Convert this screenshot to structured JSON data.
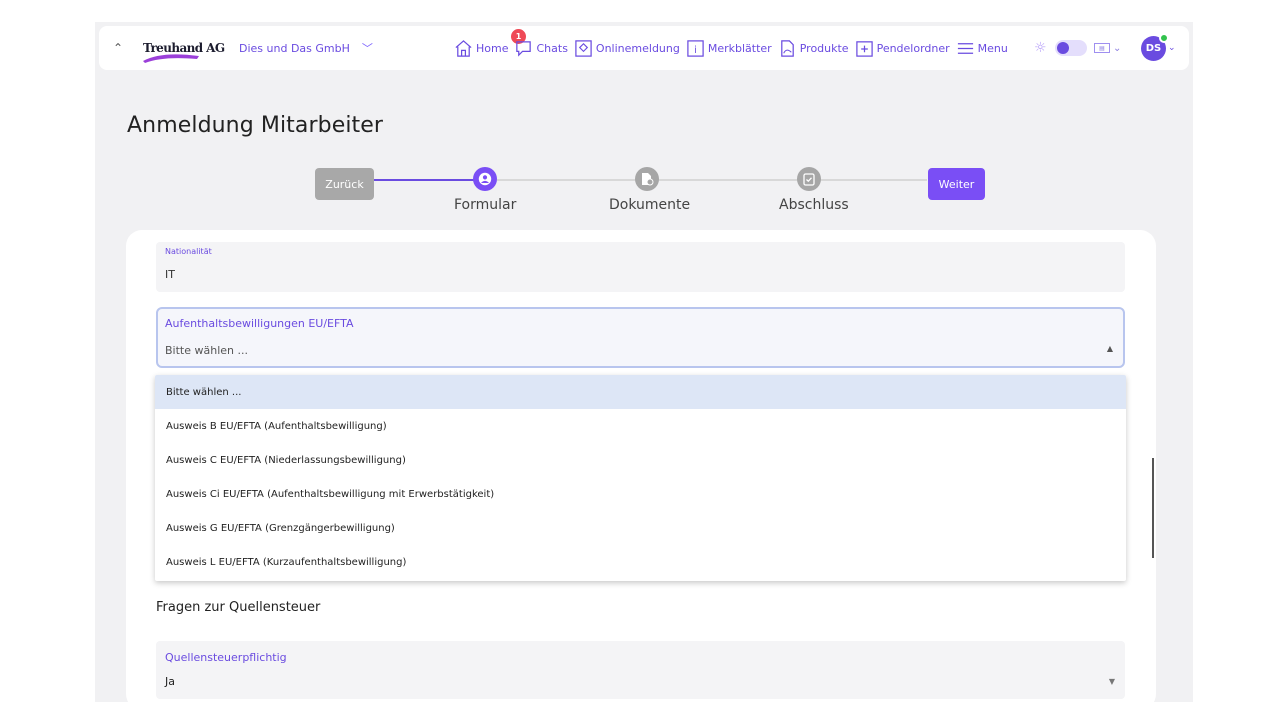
{
  "nav": {
    "logo_text": "Treuhand AG",
    "company": "Dies und Das GmbH",
    "items": [
      {
        "label": "Home",
        "icon": "home-icon",
        "badge": "1"
      },
      {
        "label": "Chats",
        "icon": "chat-icon"
      },
      {
        "label": "Onlinemeldung",
        "icon": "online-report-icon"
      },
      {
        "label": "Merkblätter",
        "icon": "info-sheet-icon"
      },
      {
        "label": "Produkte",
        "icon": "product-document-icon"
      },
      {
        "label": "Pendelordner",
        "icon": "folder-plus-icon"
      },
      {
        "label": "Menu",
        "icon": "hamburger-icon"
      }
    ],
    "user_initials": "DS",
    "colors": {
      "accent": "#6a4be0",
      "badge": "#ef4a57",
      "online": "#32c24d"
    }
  },
  "page": {
    "title": "Anmeldung Mitarbeiter",
    "back_label": "Zurück",
    "next_label": "Weiter",
    "steps": [
      {
        "label": "Formular",
        "status": "active",
        "icon": "user-circle-icon"
      },
      {
        "label": "Dokumente",
        "status": "inactive",
        "icon": "document-icon"
      },
      {
        "label": "Abschluss",
        "status": "inactive",
        "icon": "clipboard-check-icon"
      }
    ]
  },
  "form": {
    "nationality": {
      "label": "Nationalität",
      "value": "IT"
    },
    "permit": {
      "label": "Aufenthaltsbewilligungen EU/EFTA",
      "value": "Bitte wählen ...",
      "options": [
        "Bitte wählen ...",
        "Ausweis B EU/EFTA (Aufenthaltsbewilligung)",
        "Ausweis C EU/EFTA (Niederlassungsbewilligung)",
        "Ausweis Ci EU/EFTA (Aufenthaltsbewilligung mit Erwerbstätigkeit)",
        "Ausweis G EU/EFTA (Grenzgängerbewilligung)",
        "Ausweis L EU/EFTA (Kurzaufenthaltsbewilligung)"
      ]
    },
    "section_title": "Fragen zur Quellensteuer",
    "tax": {
      "label": "Quellensteuerpflichtig",
      "value": "Ja"
    }
  }
}
